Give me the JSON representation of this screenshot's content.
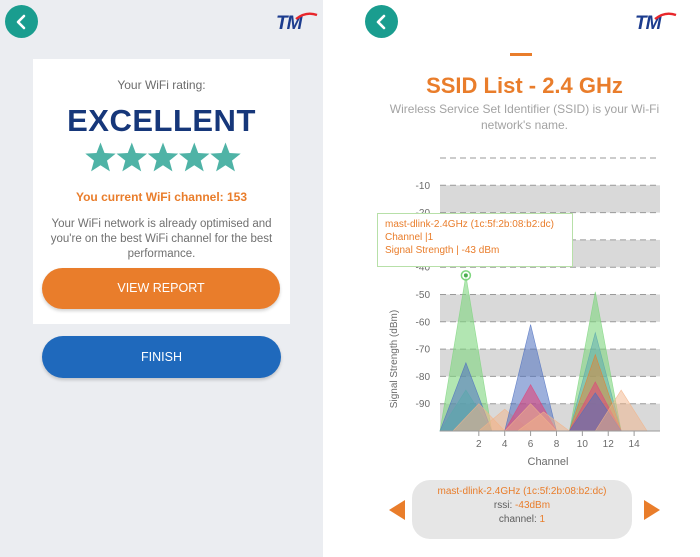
{
  "left": {
    "logo_text": "TM",
    "rating_label": "Your WiFi rating:",
    "rating_value": "EXCELLENT",
    "stars": {
      "filled": 5,
      "total": 5
    },
    "channel_text": "You current WiFi channel: 153",
    "description": "Your WiFi network is already optimised and you're on the best WiFi channel for the best performance.",
    "view_report_label": "VIEW REPORT",
    "finish_label": "FINISH"
  },
  "right": {
    "logo_text": "TM",
    "title": "SSID List - 2.4 GHz",
    "subtitle": "Wireless Service Set Identifier (SSID) is your Wi-Fi network's name.",
    "tooltip": {
      "ssid": "mast-dlink-2.4GHz (1c:5f:2b:08:b2:dc)",
      "channel": "Channel |1",
      "signal": "Signal Strength | -43 dBm"
    },
    "navigator": {
      "ssid": "mast-dlink-2.4GHz (1c:5f:2b:08:b2:dc)",
      "rssi_label": "rssi:",
      "rssi_value": "-43dBm",
      "channel_label": "channel:",
      "channel_value": "1"
    }
  },
  "colors": {
    "teal": "#1a9d8f",
    "orange": "#e97d2b",
    "navy": "#16377a",
    "blue": "#1f69bc"
  },
  "chart_data": {
    "type": "area",
    "title": "",
    "xlabel": "Channel",
    "ylabel": "Signal Strength (dBm)",
    "xticks": [
      2,
      4,
      6,
      8,
      10,
      12,
      14
    ],
    "yticks": [
      -10,
      -20,
      -30,
      -40,
      -50,
      -60,
      -70,
      -80,
      -90
    ],
    "xlim": [
      -1,
      16
    ],
    "ylim": [
      -100,
      0
    ],
    "grid": true,
    "series": [
      {
        "channel": 1,
        "peak": -43,
        "color": "#7ed67e",
        "opacity": 0.6
      },
      {
        "channel": 1,
        "peak": -75,
        "color": "#4d6fc0",
        "opacity": 0.55
      },
      {
        "channel": 1,
        "peak": -85,
        "color": "#5aa7ad",
        "opacity": 0.55
      },
      {
        "channel": 2,
        "peak": -90,
        "color": "#f2b48a",
        "opacity": 0.55
      },
      {
        "channel": 4,
        "peak": -92,
        "color": "#f2b48a",
        "opacity": 0.5
      },
      {
        "channel": 6,
        "peak": -61,
        "color": "#4d6fc0",
        "opacity": 0.55
      },
      {
        "channel": 6,
        "peak": -83,
        "color": "#e0457a",
        "opacity": 0.6
      },
      {
        "channel": 6,
        "peak": -90,
        "color": "#f2b48a",
        "opacity": 0.5
      },
      {
        "channel": 7,
        "peak": -93,
        "color": "#f2b48a",
        "opacity": 0.5
      },
      {
        "channel": 11,
        "peak": -49,
        "color": "#7ed67e",
        "opacity": 0.6
      },
      {
        "channel": 11,
        "peak": -64,
        "color": "#5aa7ad",
        "opacity": 0.5
      },
      {
        "channel": 11,
        "peak": -72,
        "color": "#e97d2b",
        "opacity": 0.45
      },
      {
        "channel": 11,
        "peak": -82,
        "color": "#e0457a",
        "opacity": 0.55
      },
      {
        "channel": 11,
        "peak": -86,
        "color": "#4d6fc0",
        "opacity": 0.55
      },
      {
        "channel": 13,
        "peak": -85,
        "color": "#f2b48a",
        "opacity": 0.5
      }
    ]
  }
}
